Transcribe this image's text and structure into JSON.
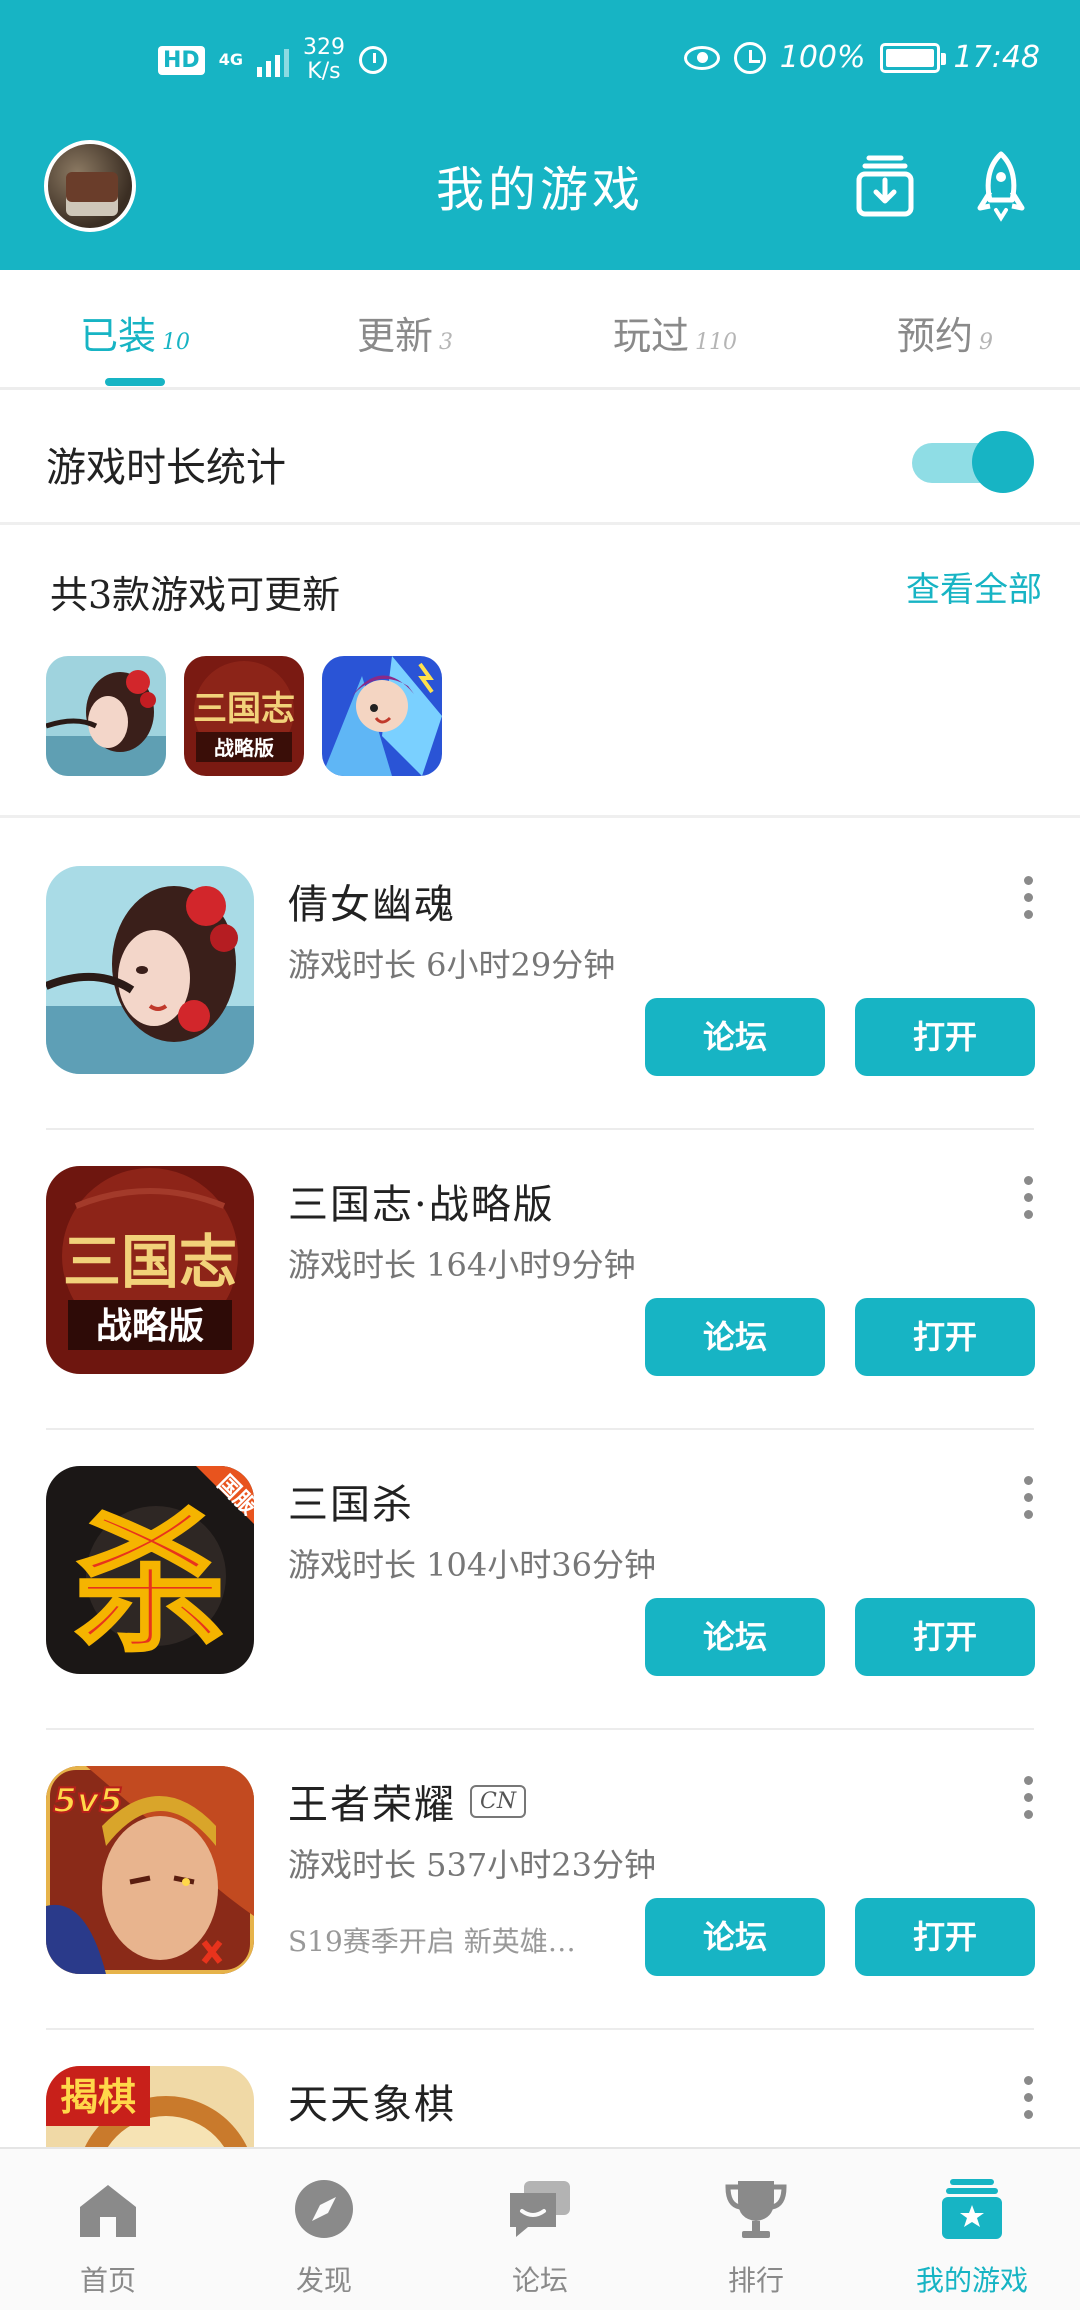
{
  "status_bar": {
    "hd": "HD",
    "network": "4G",
    "speed_value": "329",
    "speed_unit": "K/s",
    "battery": "100%",
    "time": "17:48"
  },
  "header": {
    "title": "我的游戏"
  },
  "tabs": [
    {
      "label": "已装",
      "count": "10",
      "active": true
    },
    {
      "label": "更新",
      "count": "3"
    },
    {
      "label": "玩过",
      "count": "110"
    },
    {
      "label": "预约",
      "count": "9"
    }
  ],
  "stats": {
    "label": "游戏时长统计",
    "enabled": true
  },
  "updates": {
    "title": "共3款游戏可更新",
    "view_all": "查看全部"
  },
  "games": [
    {
      "name": "倩女幽魂",
      "playtime": "游戏时长 6小时29分钟",
      "badge": "",
      "note": ""
    },
    {
      "name": "三国志·战略版",
      "playtime": "游戏时长 164小时9分钟",
      "badge": "",
      "note": ""
    },
    {
      "name": "三国杀",
      "playtime": "游戏时长 104小时36分钟",
      "badge": "",
      "note": ""
    },
    {
      "name": "王者荣耀",
      "playtime": "游戏时长 537小时23分钟",
      "badge": "CN",
      "note": "S19赛季开启 新英雄…"
    },
    {
      "name": "天天象棋",
      "playtime": "",
      "badge": "",
      "note": ""
    }
  ],
  "buttons": {
    "forum": "论坛",
    "open": "打开"
  },
  "icon_texts": {
    "sanguozhi_top": "三国志",
    "sanguozhi_bottom": "战略版",
    "sanguosha": "杀",
    "sanguosha_badge": "国服",
    "wangzhe": "5v5",
    "xiangqi": "揭棋"
  },
  "bottom_nav": [
    {
      "label": "首页",
      "icon": "home-icon"
    },
    {
      "label": "发现",
      "icon": "compass-icon"
    },
    {
      "label": "论坛",
      "icon": "chat-icon"
    },
    {
      "label": "排行",
      "icon": "trophy-icon"
    },
    {
      "label": "我的游戏",
      "icon": "my-games-icon",
      "active": true
    }
  ],
  "colors": {
    "accent": "#17b4c4",
    "text": "#222222",
    "muted": "#8a8a8a"
  }
}
